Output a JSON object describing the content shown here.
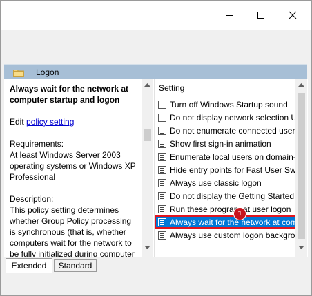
{
  "header": {
    "title": "Logon"
  },
  "description": {
    "title": "Always wait for the network at computer startup and logon",
    "edit_prefix": "Edit",
    "edit_link": "policy setting",
    "requirements_label": "Requirements:",
    "requirements_text": "At least Windows Server 2003 operating systems or Windows XP Professional",
    "description_label": "Description:",
    "description_text": "This policy setting determines whether Group Policy processing is synchronous (that is, whether computers wait for the network to be fully initialized during computer startup and user logon)."
  },
  "list": {
    "column_header": "Setting",
    "items": [
      {
        "label": "Turn off Windows Startup sound"
      },
      {
        "label": "Do not display network selection U"
      },
      {
        "label": "Do not enumerate connected users"
      },
      {
        "label": "Show first sign-in animation"
      },
      {
        "label": "Enumerate local users on domain-j"
      },
      {
        "label": "Hide entry points for Fast User Swit"
      },
      {
        "label": "Always use classic logon"
      },
      {
        "label": "Do not display the Getting Started v"
      },
      {
        "label": "Run these program at user logon"
      },
      {
        "label": "Always wait for the network at com"
      },
      {
        "label": "Always use custom logon backgrou"
      }
    ],
    "selected_index": 9
  },
  "marker": {
    "label": "1"
  },
  "tabs": [
    {
      "label": "Extended"
    },
    {
      "label": "Standard"
    }
  ],
  "colors": {
    "header_bg": "#a7bfd6",
    "selection": "#0078d7",
    "highlight_outline": "#e0141e"
  }
}
